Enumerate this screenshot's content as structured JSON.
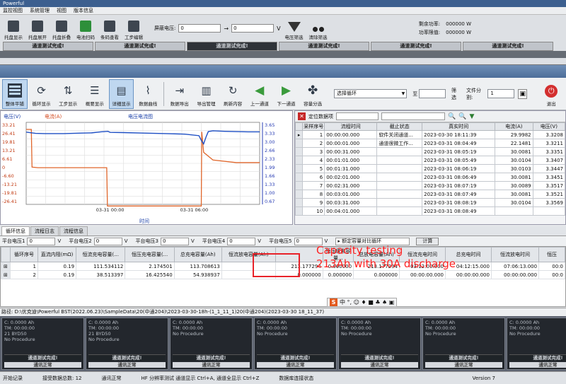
{
  "rear_window": {
    "title": "Powerful",
    "menu": [
      "监控视图",
      "系统管理",
      "视图",
      "版本信息"
    ],
    "tools": [
      "托盘显示",
      "托盘展开",
      "托盘折叠",
      "电池扫码",
      "条码查看",
      "工步编辑"
    ],
    "voltage_label": "屏蔽电压:",
    "voltage_from": "0",
    "voltage_to": "0",
    "voltage_unit": "V",
    "filter_label": "电压筛选",
    "clear_label": "清除筛选",
    "remaining_power_label": "剩余功率:",
    "remaining_power_value": "000000 W",
    "power_limit_label": "功率限值:",
    "power_limit_value": "000000 W",
    "status_cells": [
      "通道测试完成!",
      "通道测试完成!",
      "通道测试完成!",
      "通道测试完成!",
      "通道测试完成!",
      "通道测试完成!"
    ]
  },
  "toolbar": {
    "buttons": [
      "整体平铺",
      "循环显示",
      "工步显示",
      "概要显示",
      "详细显示",
      "数据曲线",
      "数据导出",
      "导出管理",
      "刷新内容",
      "上一通道",
      "下一通道",
      "容量分选"
    ],
    "cycle_select": "选择循环",
    "cycle_range_sep": "至",
    "filter_label": "筛选",
    "split_label": "文件分割:",
    "split_value": "1",
    "exit_label": "退出"
  },
  "chart": {
    "left_axis_title": "电压(V)",
    "current_label": "电流(A)",
    "title": "电压电流图",
    "x_label": "时间",
    "right_ticks": [
      "3.65",
      "3.33",
      "3.00",
      "2.66",
      "2.33",
      "1.99",
      "1.66",
      "1.33",
      "1.00",
      "0.67"
    ],
    "left_ticks": [
      "33.21",
      "26.41",
      "19.81",
      "13.21",
      "6.61",
      "0",
      "-6.60",
      "-13.21",
      "-19.81",
      "-26.41"
    ],
    "x_ticks": [
      "03-31 00:00",
      "03-31 06:00"
    ]
  },
  "chart_data": {
    "type": "line",
    "title": "电压电流图",
    "xlabel": "时间",
    "ylabel": "电压(V)",
    "y2label": "电流(A)",
    "x_ticks": [
      "03-31 00:00",
      "03-31 06:00"
    ],
    "ylim": [
      -26.41,
      33.21
    ],
    "y2lim": [
      0.67,
      3.65
    ],
    "series": [
      {
        "name": "电压(V)",
        "x": [
          0,
          0.04,
          0.08,
          0.12,
          0.16,
          0.2,
          0.24,
          0.28,
          0.32,
          0.35,
          0.36,
          0.42,
          0.5,
          0.6,
          0.68,
          0.74,
          0.75,
          0.76,
          0.77,
          0.78,
          0.8,
          0.85,
          0.9,
          0.95,
          1.0
        ],
        "y": [
          3.38,
          3.33,
          3.32,
          3.32,
          3.32,
          3.33,
          3.34,
          3.35,
          3.39,
          3.41,
          3.37,
          3.36,
          3.34,
          3.32,
          3.3,
          3.24,
          3.06,
          2.92,
          3.18,
          3.4,
          3.43,
          3.41,
          3.4,
          3.39,
          3.39
        ]
      },
      {
        "name": "电流(A)",
        "x": [
          0,
          0.022,
          0.025,
          0.05,
          0.16,
          0.34,
          0.345,
          0.348,
          0.35,
          0.36,
          0.42,
          0.6,
          0.75,
          0.752,
          0.76,
          0.8,
          0.9,
          1.0
        ],
        "y": [
          29.9,
          29.9,
          0.5,
          0,
          0,
          0,
          0,
          -29.9,
          -29.9,
          -29.9,
          -29.9,
          -29.9,
          -29.9,
          28.0,
          12.0,
          6.0,
          4.0,
          4.0
        ]
      }
    ]
  },
  "grid": {
    "query_label": "定位数据项",
    "headers": [
      "",
      "采样序号",
      "流程时间",
      "截止状态",
      "真实时间",
      "电流(A)",
      "电压(V)"
    ],
    "rows": [
      [
        "▸",
        "1",
        "00:00:00.000",
        "软件关闭通道...",
        "2023-03-30 18:11:39",
        "29.9982",
        "3.3208"
      ],
      [
        "",
        "2",
        "00:00:01.000",
        "通道很微工作...",
        "2023-03-31 08:04:49",
        "22.1481",
        "3.3211"
      ],
      [
        "",
        "3",
        "00:00:31.000",
        "",
        "2023-03-31 08:05:19",
        "30.0081",
        "3.3351"
      ],
      [
        "",
        "4",
        "00:01:01.000",
        "",
        "2023-03-31 08:05:49",
        "30.0104",
        "3.3407"
      ],
      [
        "",
        "5",
        "00:01:31.000",
        "",
        "2023-03-31 08:06:19",
        "30.0103",
        "3.3447"
      ],
      [
        "",
        "6",
        "00:02:01.000",
        "",
        "2023-03-31 08:06:49",
        "30.0081",
        "3.3451"
      ],
      [
        "",
        "7",
        "00:02:31.000",
        "",
        "2023-03-31 08:07:19",
        "30.0089",
        "3.3517"
      ],
      [
        "",
        "8",
        "00:03:01.000",
        "",
        "2023-03-31 08:07:49",
        "30.0081",
        "3.3521"
      ],
      [
        "",
        "9",
        "00:03:31.000",
        "",
        "2023-03-31 08:08:19",
        "30.0104",
        "3.3569"
      ],
      [
        "",
        "10",
        "00:04:01.000",
        "",
        "2023-03-31 08:08:49",
        "",
        ""
      ]
    ]
  },
  "tabs": [
    "循环信息",
    "流程日志",
    "流程信息"
  ],
  "plateau": {
    "labels": [
      "平台电压1",
      "平台电压2",
      "平台电压3",
      "平台电压4",
      "平台电压5"
    ],
    "values": [
      "0",
      "0",
      "0",
      "0",
      "0"
    ],
    "unit": "V",
    "mode": "▸ 额定容量对比循环",
    "calc_button": "计算"
  },
  "bottom_table": {
    "headers": [
      "",
      "循环序号",
      "直流内阻(mΩ)",
      "恒流充电容量(...",
      "恒压充电容量(...",
      "总充电容量(Ah)",
      "恒流放电容量(Ah)",
      "",
      "恒压放电容量...",
      "总放电容量(Ah)",
      "恒流充电时间",
      "总充电时间",
      "恒流放电时间",
      "恒压"
    ],
    "rows": [
      [
        "⊞",
        "1",
        "0.19",
        "111.534112",
        "2.174501",
        "113.708613",
        "",
        "213.177294",
        "0.000000",
        "213.177294",
        "03:12:00.000",
        "04:12:15.000",
        "07:06:13.000",
        "00:0"
      ],
      [
        "⊞",
        "2",
        "0.19",
        "38.513397",
        "16.425540",
        "54.938937",
        "",
        "0.000000",
        "0.000000",
        "0.000000",
        "00:00:00.000",
        "00:00:00.000",
        "00:00:00.000",
        "00:0"
      ]
    ]
  },
  "annotation": {
    "line1": "Capacity testing",
    "line2": "213Ah with 30A discharge"
  },
  "path": "路径: D:\\优克迪\\Powerful BST(2022.06.23)\\SampleData\\20(中通204)\\2023-03-30-18h-(1_1_11_1)20(中通204)(2023-03-30 18_11_37)",
  "lang_bar": "中 °, ☺ ♦ ■ ♣ ♠ ▣",
  "channels": [
    {
      "c": "C: 0.0000 Ah",
      "tm": "TM: 00:00:00",
      "id": "21 BYD50",
      "proc": "No Procedure",
      "done": "通道测试完成!",
      "status": "通讯正常"
    },
    {
      "c": "C: 0.0000 Ah",
      "tm": "TM: 00:00:00",
      "id": "21 BYD50",
      "proc": "No Procedure",
      "done": "通道测试完成!",
      "status": "通讯正常"
    },
    {
      "c": "C: 0.0000 Ah",
      "tm": "TM: 00:00:00",
      "id": "No Procedure",
      "proc": "",
      "done": "通道测试完成!",
      "status": "通讯正常"
    },
    {
      "c": "C: 0.0000 Ah",
      "tm": "TM: 00:00:00",
      "id": "No Procedure",
      "proc": "",
      "done": "通道测试完成!",
      "status": "通讯正常"
    },
    {
      "c": "C: 0.0000 Ah",
      "tm": "TM: 00:00:00",
      "id": "No Procedure",
      "proc": "",
      "done": "通道测试完成!",
      "status": "通讯正常"
    },
    {
      "c": "C: 0.0000 Ah",
      "tm": "TM: 00:00:00",
      "id": "No Procedure",
      "proc": "",
      "done": "通道测试完成!",
      "status": "通讯正常"
    },
    {
      "c": "C: 0.0000 Ah",
      "tm": "TM: 00:00:00",
      "id": "No Procedure",
      "proc": "",
      "done": "通道测试完成!",
      "status": "通讯正常"
    }
  ],
  "statusbar": {
    "items": [
      "开始记录",
      "接受数据总数: 12",
      "通讯正常",
      "HF 分辨率测试 通道显示 Ctrl+A, 通道全显示 Ctrl+Z",
      "数据库连接状态",
      "Version 7"
    ]
  }
}
